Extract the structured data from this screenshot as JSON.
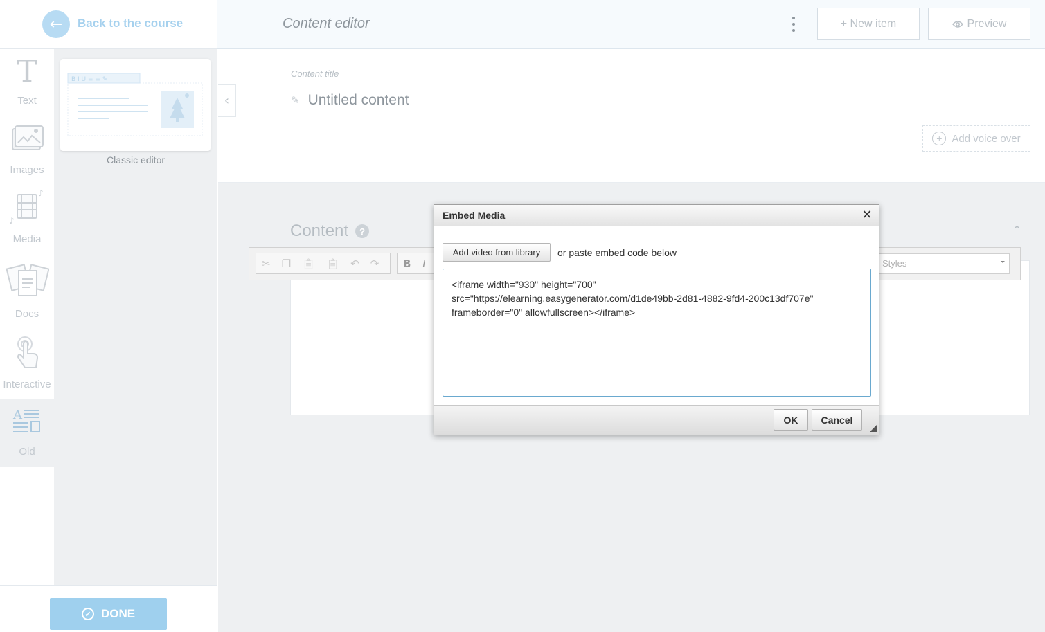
{
  "header": {
    "back_label": "Back to the course",
    "title": "Content editor",
    "new_item_label": "+ New item",
    "preview_label": "Preview"
  },
  "rail": {
    "items": [
      {
        "label": "Text",
        "icon": "text-icon"
      },
      {
        "label": "Images",
        "icon": "images-icon"
      },
      {
        "label": "Media",
        "icon": "media-icon"
      },
      {
        "label": "Docs",
        "icon": "docs-icon"
      },
      {
        "label": "Interactive",
        "icon": "interactive-icon"
      },
      {
        "label": "Old",
        "icon": "old-layout-icon",
        "active": true
      }
    ]
  },
  "gallery": {
    "card_caption": "Classic editor"
  },
  "footer": {
    "done_label": "DONE"
  },
  "content_title": {
    "label": "Content title",
    "value": "Untitled content",
    "voice_over_label": "Add voice over"
  },
  "content": {
    "heading": "Content",
    "styles_placeholder": "Styles"
  },
  "dialog": {
    "title": "Embed Media",
    "library_button": "Add video from library",
    "paste_hint": "or paste embed code below",
    "embed_code": "<iframe width=\"930\" height=\"700\"\nsrc=\"https://elearning.easygenerator.com/d1de49bb-2d81-4882-9fd4-200c13df707e\"\nframeborder=\"0\" allowfullscreen></iframe>",
    "ok_label": "OK",
    "cancel_label": "Cancel"
  },
  "colors": {
    "accent": "#9fd0ee",
    "back_circle": "#b7dbf3",
    "rail_text": "#c3c9cf",
    "panel_bg": "#eef0f2"
  }
}
